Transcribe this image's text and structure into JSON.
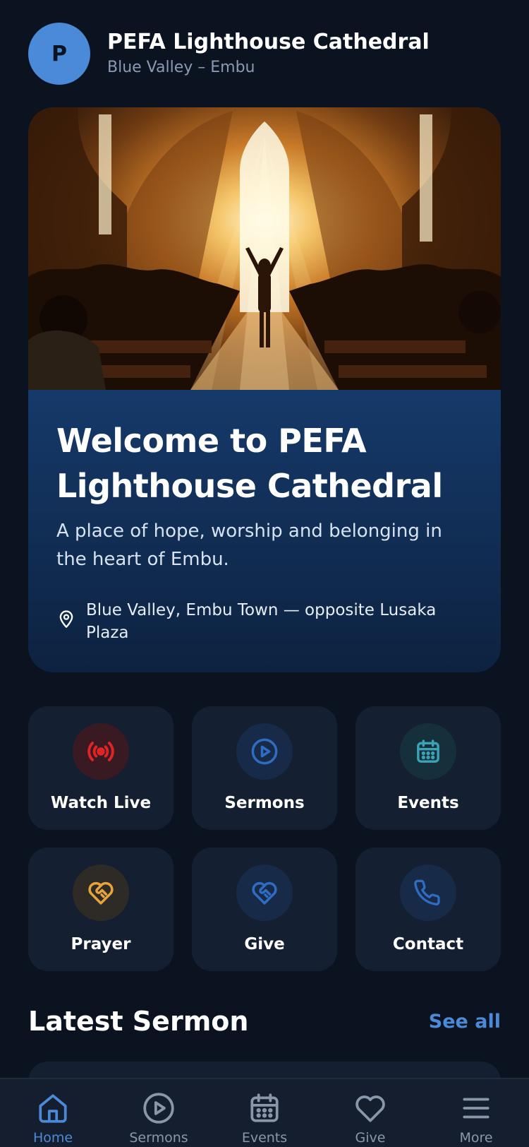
{
  "header": {
    "avatar_letter": "P",
    "title": "PEFA Lighthouse Cathedral",
    "subtitle": "Blue Valley – Embu"
  },
  "hero": {
    "image_icon": "church-worship-photo",
    "title": "Welcome to PEFA Lighthouse Cathedral",
    "description": "A place of hope, worship and belonging in the heart of Embu.",
    "location_icon": "map-pin-icon",
    "location": "Blue Valley, Embu Town — opposite Lusaka Plaza"
  },
  "actions": [
    {
      "label": "Watch Live",
      "icon": "broadcast-icon",
      "color": "#e02424",
      "bg": "#3a1a22"
    },
    {
      "label": "Sermons",
      "icon": "play-circle-icon",
      "color": "#2f6cc4",
      "bg": "#172a47"
    },
    {
      "label": "Events",
      "icon": "calendar-icon",
      "color": "#3aa3b8",
      "bg": "#16303b"
    },
    {
      "label": "Prayer",
      "icon": "heart-handshake-icon",
      "color": "#e8a33a",
      "bg": "#2e2a26"
    },
    {
      "label": "Give",
      "icon": "heart-handshake-icon",
      "color": "#2f6cc4",
      "bg": "#172a47"
    },
    {
      "label": "Contact",
      "icon": "phone-icon",
      "color": "#2f6cc4",
      "bg": "#172a47"
    }
  ],
  "latest_sermon": {
    "title": "Latest Sermon",
    "see_all": "See all"
  },
  "bottom_nav": [
    {
      "label": "Home",
      "icon": "home-icon",
      "active": true
    },
    {
      "label": "Sermons",
      "icon": "play-circle-icon",
      "active": false
    },
    {
      "label": "Events",
      "icon": "calendar-icon",
      "active": false
    },
    {
      "label": "Give",
      "icon": "heart-icon",
      "active": false
    },
    {
      "label": "More",
      "icon": "menu-icon",
      "active": false
    }
  ],
  "colors": {
    "background": "#0b1220",
    "accent": "#4a8ad8",
    "tile": "#141f31"
  }
}
